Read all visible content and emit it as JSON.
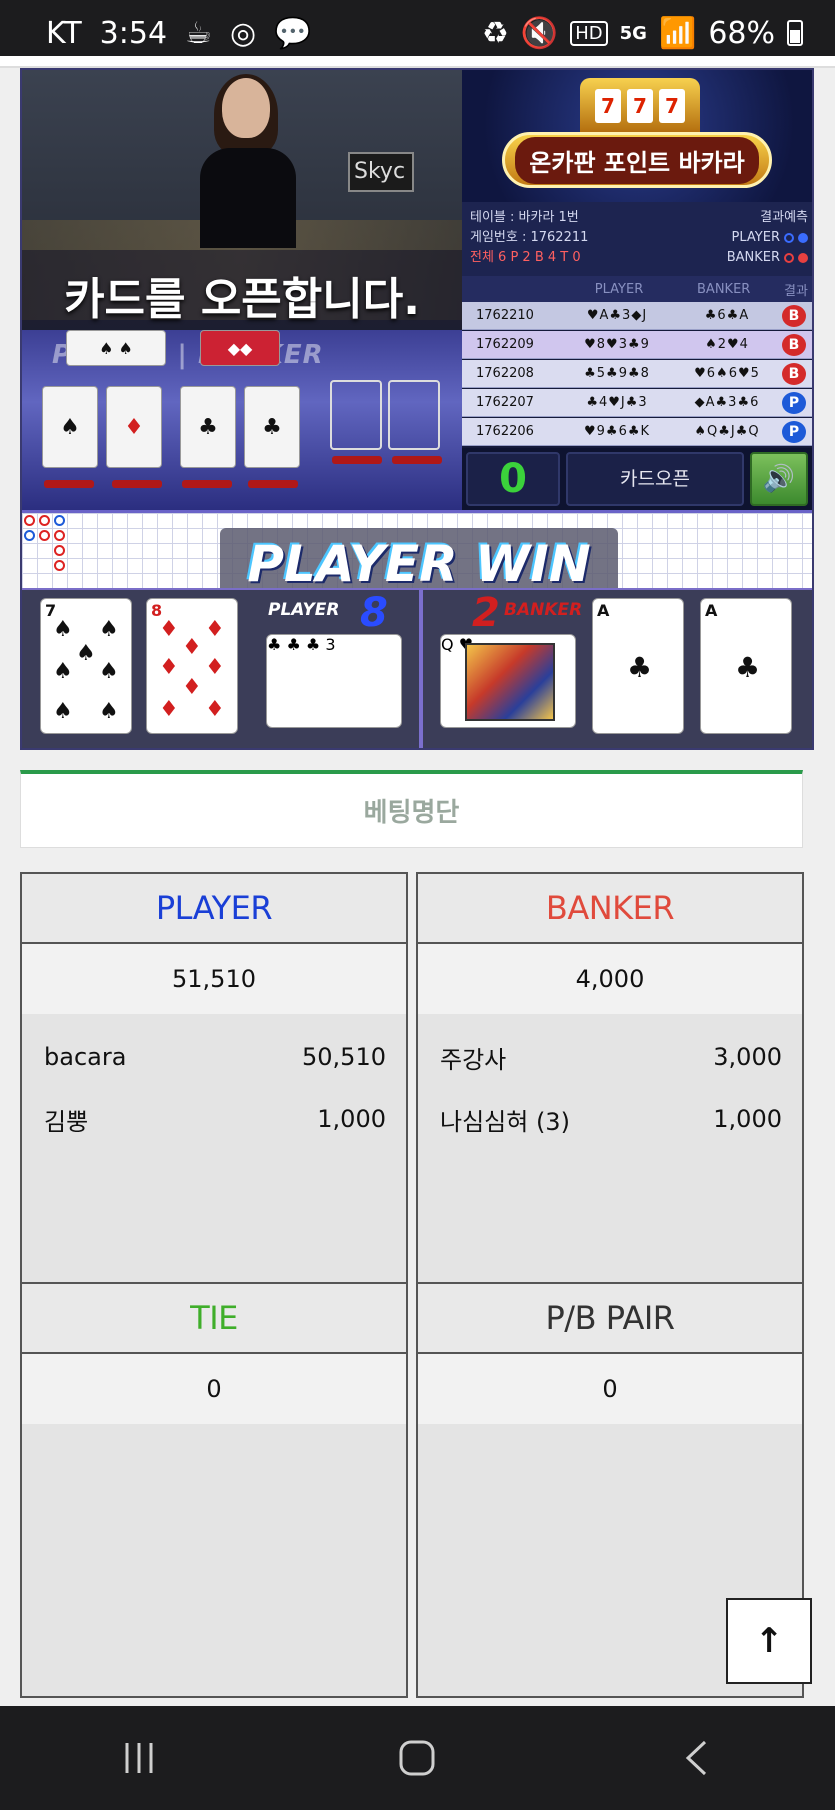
{
  "status": {
    "carrier": "KT",
    "time": "3:54",
    "battery": "68%",
    "network": "5G"
  },
  "game": {
    "announcement": "카드를 오픈합니다.",
    "video_sign": "Skyc",
    "pb_label": "PLAYER | BANKER",
    "logo_text": "온카판 포인트 바카라",
    "table_label": "테이블 : 바카라 1번",
    "predict_label": "결과예측",
    "game_no": "게임번호 : 1762211",
    "player_word": "PLAYER",
    "banker_word": "BANKER",
    "summary": "전체 6  P 2  B 4  T 0",
    "history_headers": [
      "",
      "PLAYER",
      "BANKER",
      "결과"
    ],
    "history": [
      {
        "id": "1762210",
        "player": "♥A♣3◆J",
        "banker": "♣6♣A",
        "result": "B"
      },
      {
        "id": "1762209",
        "player": "♥8♥3♣9",
        "banker": "♠2♥4",
        "result": "B"
      },
      {
        "id": "1762208",
        "player": "♣5♣9♣8",
        "banker": "♥6♠6♥5",
        "result": "B"
      },
      {
        "id": "1762207",
        "player": "♣4♥J♣3",
        "banker": "◆A♣3♣6",
        "result": "P"
      },
      {
        "id": "1762206",
        "player": "♥9♣6♣K",
        "banker": "♠Q♣J♣Q",
        "result": "P"
      }
    ],
    "counter": "0",
    "open_button": "카드오픈",
    "win_text": "PLAYER WIN",
    "player_label": "PLAYER",
    "player_score": "8",
    "banker_label": "BANKER",
    "banker_score": "2",
    "player_cards": [
      {
        "rank": "7",
        "suit": "♠",
        "color": "black"
      },
      {
        "rank": "8",
        "suit": "♦",
        "color": "red"
      },
      {
        "rank": "3",
        "suit": "♣",
        "color": "black"
      }
    ],
    "banker_cards": [
      {
        "rank": "Q",
        "suit": "♥",
        "color": "red"
      },
      {
        "rank": "A",
        "suit": "♣",
        "color": "black"
      },
      {
        "rank": "A",
        "suit": "♣",
        "color": "black"
      }
    ]
  },
  "betting": {
    "title": "베팅명단",
    "player": {
      "label": "PLAYER",
      "total": "51,510",
      "items": [
        {
          "name": "bacara",
          "amount": "50,510"
        },
        {
          "name": "김뿡",
          "amount": "1,000"
        }
      ]
    },
    "banker": {
      "label": "BANKER",
      "total": "4,000",
      "items": [
        {
          "name": "주강사",
          "amount": "3,000"
        },
        {
          "name": "나심심혀 (3)",
          "amount": "1,000"
        }
      ]
    },
    "tie": {
      "label": "TIE",
      "total": "0"
    },
    "pair": {
      "label": "P/B PAIR",
      "total": "0"
    }
  },
  "scroll_top": "↑",
  "colors": {
    "player": "#1a3fd6",
    "banker": "#e04a3c",
    "tie": "#3fae2a",
    "accent": "#2a9a4a"
  }
}
